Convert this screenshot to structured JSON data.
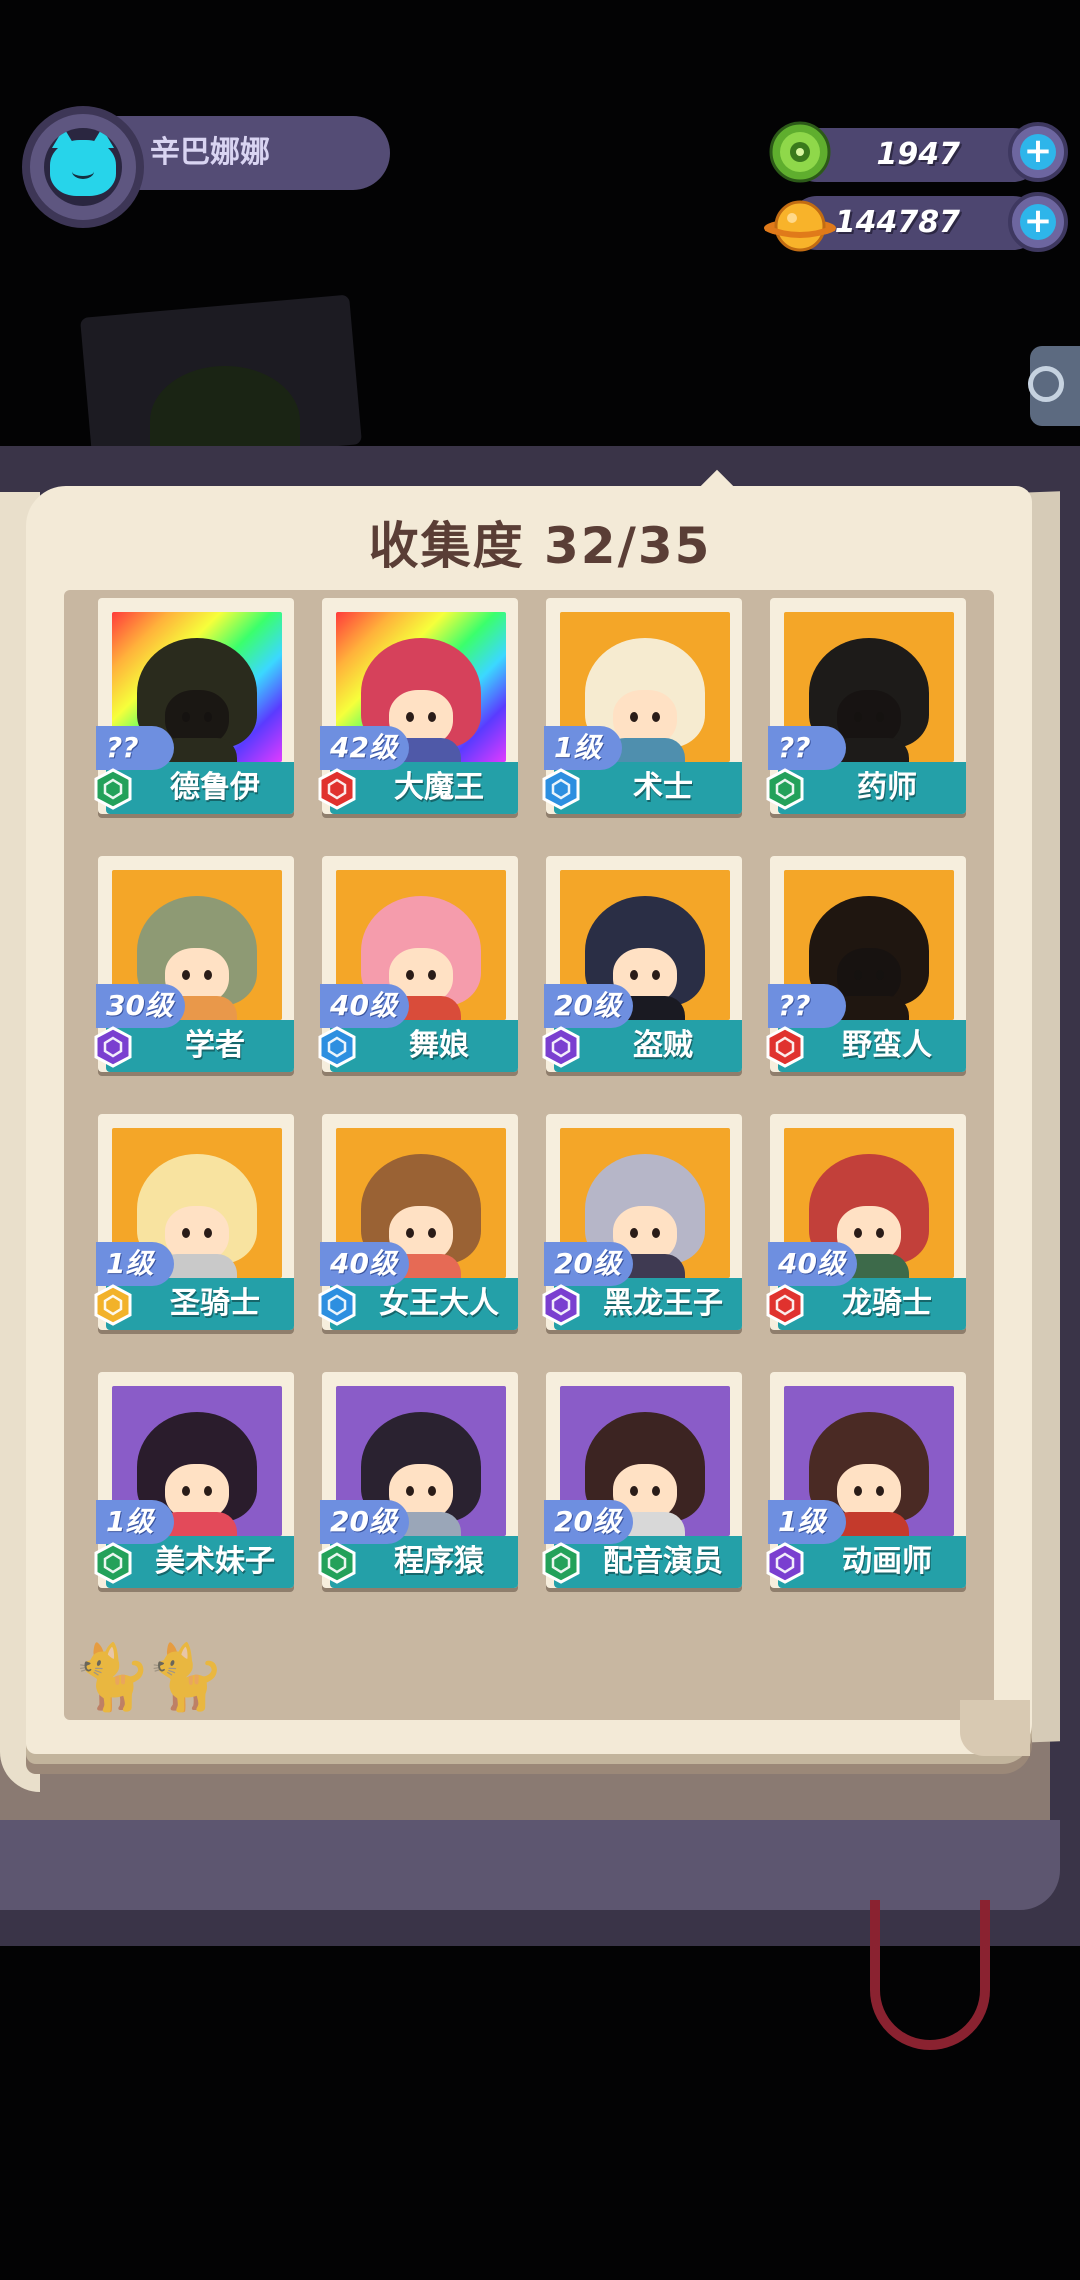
{
  "player": {
    "name": "辛巴娜娜"
  },
  "currencies": [
    {
      "id": "green-gem",
      "value": "1947",
      "color": "#7cc43a"
    },
    {
      "id": "gold-planet",
      "value": "144787",
      "color": "#f7a823"
    }
  ],
  "collection": {
    "title": "收集度 32/35",
    "role_colors": {
      "green": "#23a15a",
      "red": "#e0322e",
      "blue": "#2d8fe0",
      "purple": "#7a3fd0",
      "gold": "#f2b22a"
    },
    "cards": [
      {
        "name": "德鲁伊",
        "level": "??",
        "bg": "rainbow",
        "role": "green",
        "locked": true,
        "hair": "#2a2b1d",
        "body": "#2a2b1d"
      },
      {
        "name": "大魔王",
        "level": "42级",
        "bg": "rainbow",
        "role": "red",
        "locked": false,
        "hair": "#d6415b",
        "body": "#4f59a8"
      },
      {
        "name": "术士",
        "level": "1级",
        "bg": "gold",
        "role": "blue",
        "locked": false,
        "hair": "#f6ebd0",
        "body": "#4f8fae"
      },
      {
        "name": "药师",
        "level": "??",
        "bg": "gold",
        "role": "green",
        "locked": true,
        "hair": "#1d1b19",
        "body": "#1d1b19"
      },
      {
        "name": "学者",
        "level": "30级",
        "bg": "gold",
        "role": "purple",
        "locked": false,
        "hair": "#8e9a74",
        "body": "#e9984a"
      },
      {
        "name": "舞娘",
        "level": "40级",
        "bg": "gold",
        "role": "blue",
        "locked": false,
        "hair": "#f59cac",
        "body": "#d94c3a"
      },
      {
        "name": "盗贼",
        "level": "20级",
        "bg": "gold",
        "role": "purple",
        "locked": false,
        "hair": "#2a2e45",
        "body": "#1a1a22"
      },
      {
        "name": "野蛮人",
        "level": "??",
        "bg": "gold",
        "role": "red",
        "locked": true,
        "hair": "#1f1610",
        "body": "#1f1610"
      },
      {
        "name": "圣骑士",
        "level": "1级",
        "bg": "gold",
        "role": "gold",
        "locked": false,
        "hair": "#f8e3a0",
        "body": "#c9c9c9"
      },
      {
        "name": "女王大人",
        "level": "40级",
        "bg": "gold",
        "role": "blue",
        "locked": false,
        "hair": "#9a6234",
        "body": "#e66a55"
      },
      {
        "name": "黑龙王子",
        "level": "20级",
        "bg": "gold",
        "role": "purple",
        "locked": false,
        "hair": "#b6b6c8",
        "body": "#3f3a52"
      },
      {
        "name": "龙骑士",
        "level": "40级",
        "bg": "gold",
        "role": "red",
        "locked": false,
        "hair": "#c2403a",
        "body": "#3d6a4a"
      },
      {
        "name": "美术妹子",
        "level": "1级",
        "bg": "purple",
        "role": "green",
        "locked": false,
        "hair": "#2a1c2c",
        "body": "#e34a5a"
      },
      {
        "name": "程序猿",
        "level": "20级",
        "bg": "purple",
        "role": "green",
        "locked": false,
        "hair": "#2a2230",
        "body": "#9aa6b8"
      },
      {
        "name": "配音演员",
        "level": "20级",
        "bg": "purple",
        "role": "green",
        "locked": false,
        "hair": "#3c2422",
        "body": "#d8d8d8"
      },
      {
        "name": "动画师",
        "level": "1级",
        "bg": "purple",
        "role": "purple",
        "locked": false,
        "hair": "#4a2a24",
        "body": "#c43a2c"
      }
    ]
  }
}
